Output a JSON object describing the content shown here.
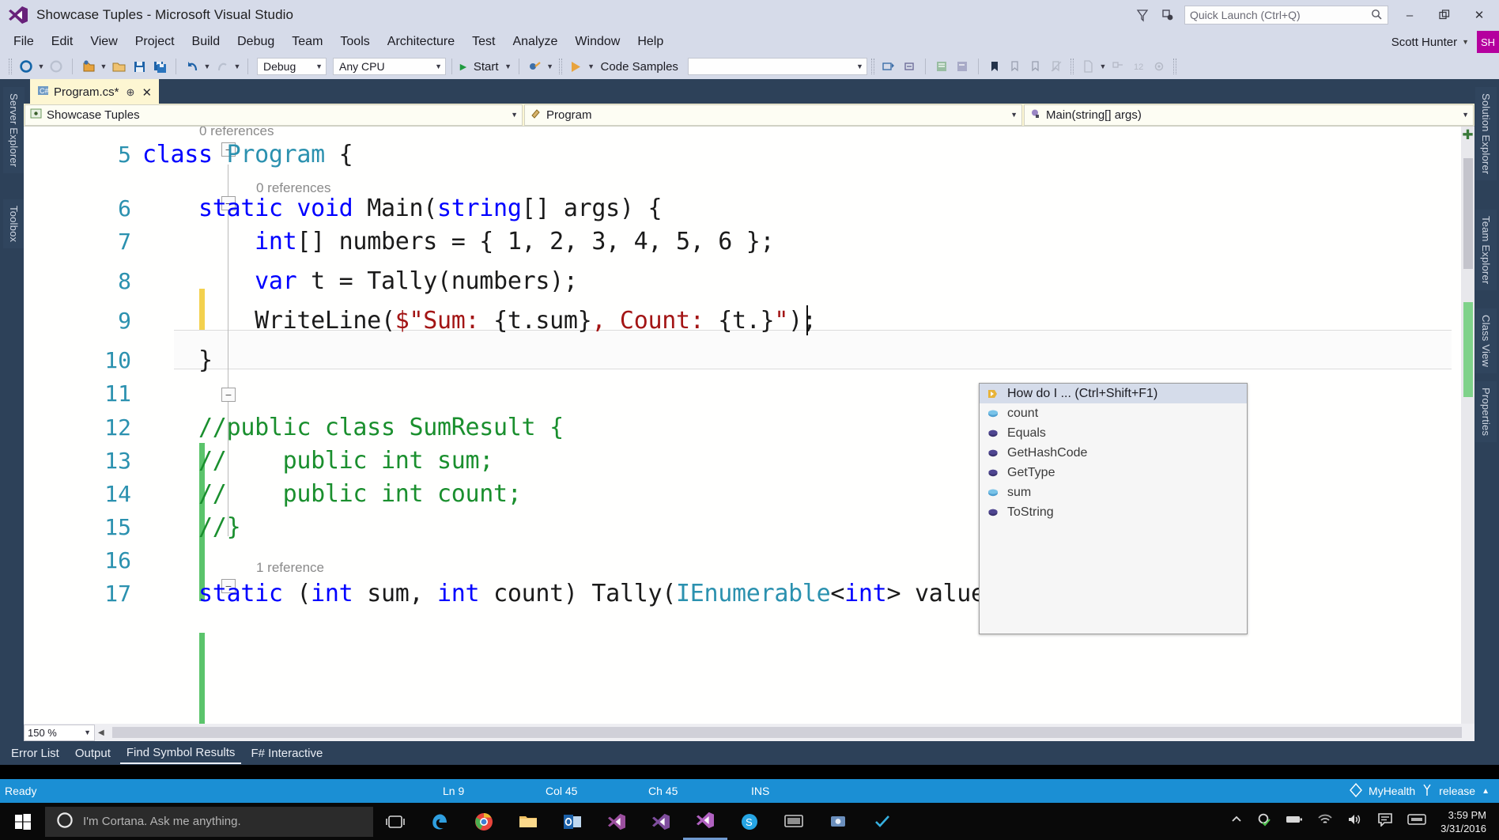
{
  "titlebar": {
    "title": "Showcase Tuples - Microsoft Visual Studio",
    "quick_launch_placeholder": "Quick Launch (Ctrl+Q)",
    "minimize": "–",
    "restore": "❐",
    "close": "✕",
    "feedback_icon": "feedback-icon",
    "notify_icon": "notification-icon"
  },
  "menubar": {
    "items": [
      {
        "label": "File"
      },
      {
        "label": "Edit"
      },
      {
        "label": "View"
      },
      {
        "label": "Project"
      },
      {
        "label": "Build"
      },
      {
        "label": "Debug"
      },
      {
        "label": "Team"
      },
      {
        "label": "Tools"
      },
      {
        "label": "Architecture"
      },
      {
        "label": "Test"
      },
      {
        "label": "Analyze"
      },
      {
        "label": "Window"
      },
      {
        "label": "Help"
      }
    ],
    "account_name": "Scott Hunter",
    "account_initials": "SH"
  },
  "toolbar": {
    "config": "Debug",
    "platform": "Any CPU",
    "start_label": "Start",
    "code_samples_label": "Code Samples",
    "code_samples_value": ""
  },
  "tabs": {
    "document": {
      "name": "Program.cs*",
      "pin_glyph": "⊕",
      "close_glyph": "✕"
    }
  },
  "rails": {
    "left": [
      "Server Explorer",
      "Toolbox"
    ],
    "right": [
      "Solution Explorer",
      "Team Explorer",
      "Class View",
      "Properties"
    ]
  },
  "navbar": {
    "project": "Showcase Tuples",
    "type": "Program",
    "member": "Main(string[] args)"
  },
  "editor": {
    "zoom": "150 %",
    "reference_labels": [
      {
        "text": "0 references"
      },
      {
        "text": "0 references"
      },
      {
        "text": "1 reference"
      }
    ],
    "lines": [
      {
        "num": "5",
        "text": "class Program {"
      },
      {
        "num": "6",
        "text": "    static void Main(string[] args) {"
      },
      {
        "num": "7",
        "text": "        int[] numbers = { 1, 2, 3, 4, 5, 6 };"
      },
      {
        "num": "8",
        "text": "        var t = Tally(numbers);"
      },
      {
        "num": "9",
        "text": "        WriteLine($\"Sum: {t.sum}, Count: {t.}\");"
      },
      {
        "num": "10",
        "text": "    }"
      },
      {
        "num": "11",
        "text": ""
      },
      {
        "num": "12",
        "text": "    //public class SumResult {"
      },
      {
        "num": "13",
        "text": "    //    public int sum;"
      },
      {
        "num": "14",
        "text": "    //    public int count;"
      },
      {
        "num": "15",
        "text": "    //}"
      },
      {
        "num": "16",
        "text": ""
      },
      {
        "num": "17",
        "text": "    static (int sum, int count) Tally(IEnumerable<int> values) {"
      }
    ]
  },
  "intellisense": {
    "items": [
      {
        "label": "How do I ...  (Ctrl+Shift+F1)",
        "icon": "lightbulb-icon",
        "selected": true
      },
      {
        "label": "count",
        "icon": "field-icon",
        "selected": false
      },
      {
        "label": "Equals",
        "icon": "method-icon",
        "selected": false
      },
      {
        "label": "GetHashCode",
        "icon": "method-icon",
        "selected": false
      },
      {
        "label": "GetType",
        "icon": "method-icon",
        "selected": false
      },
      {
        "label": "sum",
        "icon": "field-icon",
        "selected": false
      },
      {
        "label": "ToString",
        "icon": "method-icon",
        "selected": false
      }
    ]
  },
  "panel_tabs": [
    {
      "label": "Error List",
      "active": false
    },
    {
      "label": "Output",
      "active": false
    },
    {
      "label": "Find Symbol Results",
      "active": true
    },
    {
      "label": "F# Interactive",
      "active": false
    }
  ],
  "statusbar": {
    "state": "Ready",
    "line": "Ln 9",
    "col": "Col 45",
    "ch": "Ch 45",
    "insert_mode": "INS",
    "repo": "MyHealth",
    "branch": "release",
    "branch_caret": "▲"
  },
  "taskbar": {
    "cortana_text": "I'm Cortana. Ask me anything.",
    "time": "3:59 PM",
    "date": "3/31/2016"
  },
  "colors": {
    "chrome": "#d6dbe9",
    "dock": "#2d4159",
    "tab_active": "#fdf6d2",
    "status": "#1b8fd4",
    "accent_magenta": "#b5009e",
    "keyword": "#0000ff",
    "type": "#2b91af",
    "string": "#a31515",
    "comment": "#1a8f2e",
    "linenum": "#2b91af"
  }
}
